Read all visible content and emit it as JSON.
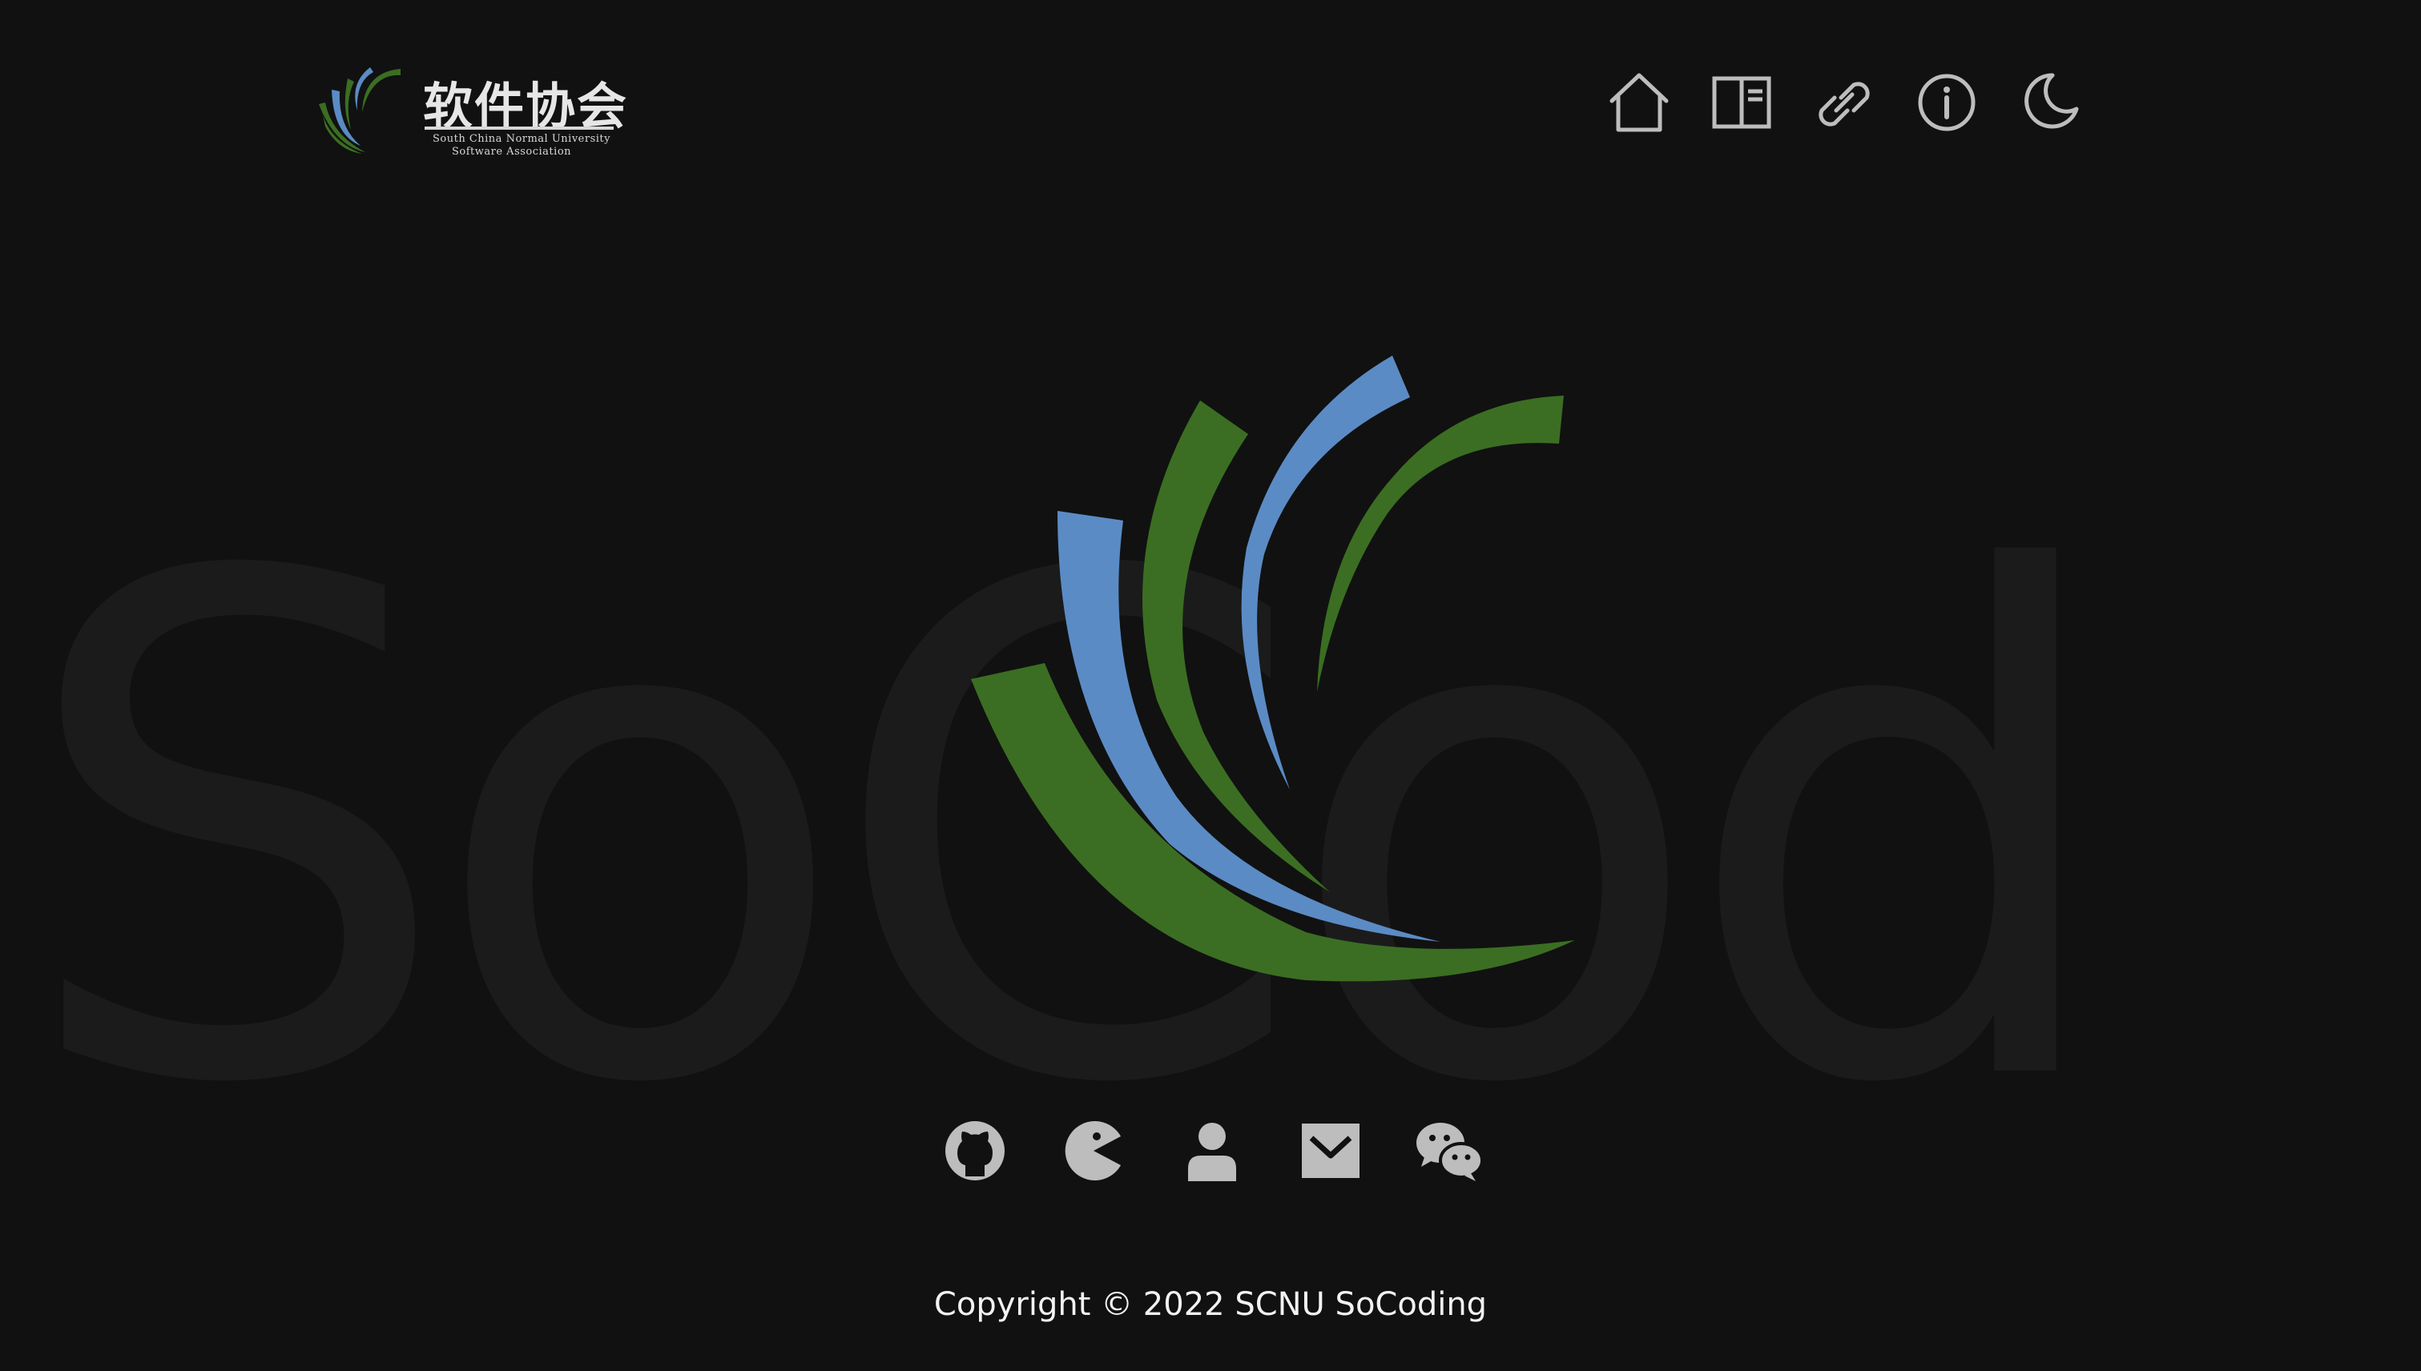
{
  "background_text": "SoCod",
  "brand": {
    "name_zh": "软件协会",
    "name_en_line1": "South China Normal University",
    "name_en_line2": "Software Association"
  },
  "nav": {
    "items": [
      {
        "icon": "home-icon"
      },
      {
        "icon": "book-icon"
      },
      {
        "icon": "link-icon"
      },
      {
        "icon": "info-icon"
      },
      {
        "icon": "moon-icon"
      }
    ]
  },
  "social": {
    "items": [
      {
        "icon": "github-icon"
      },
      {
        "icon": "pacman-icon"
      },
      {
        "icon": "user-icon"
      },
      {
        "icon": "mail-icon"
      },
      {
        "icon": "wechat-icon"
      }
    ]
  },
  "footer": {
    "copyright": "Copyright © 2022 SCNU SoCoding"
  },
  "colors": {
    "background": "#111111",
    "watermark": "#1b1b1b",
    "icon": "#bdbdbd",
    "logo_green": "#3b6e22",
    "logo_blue": "#5b8bc5",
    "text": "#f2f2f2"
  }
}
